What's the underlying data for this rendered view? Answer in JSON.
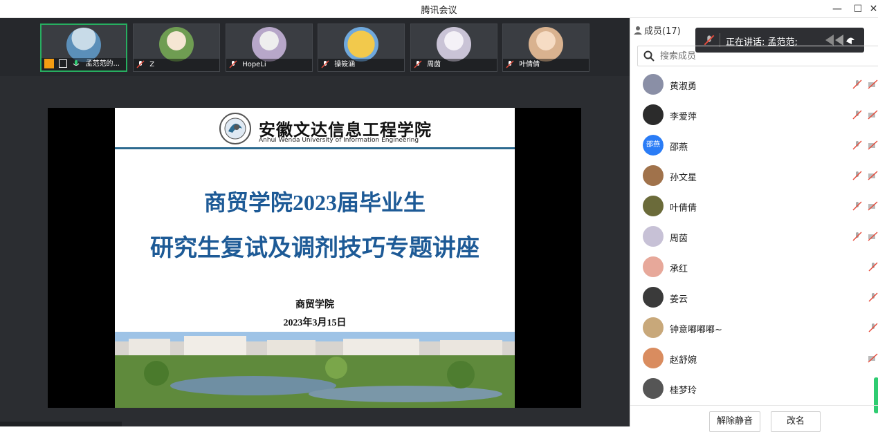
{
  "window": {
    "title": "腾讯会议",
    "minimize": "—",
    "maximize": "☐",
    "close": "✕"
  },
  "video_strip": [
    {
      "name": "孟范范的...",
      "active": true,
      "color": "#5b8fb9"
    },
    {
      "name": "Z",
      "active": false,
      "color": "#6f9d52"
    },
    {
      "name": "HopeLi",
      "active": false,
      "color": "#b7a7c9"
    },
    {
      "name": "操筱涵",
      "active": false,
      "color": "#f2c94c"
    },
    {
      "name": "周茵",
      "active": false,
      "color": "#c9c3d6"
    },
    {
      "name": "叶倩倩",
      "active": false,
      "color": "#d9b28f"
    }
  ],
  "slide": {
    "university_cn": "安徽文达信息工程学院",
    "university_en": "Anhui Wenda University of Information Engineering",
    "title_line1": "商贸学院2023届毕业生",
    "title_line2": "研究生复试及调剂技巧专题讲座",
    "organizer": "商贸学院",
    "date": "2023年3月15日"
  },
  "panel": {
    "members_label": "成员(17)",
    "speaking_popup": "正在讲话: 孟范范;",
    "search_placeholder": "搜索成员",
    "members": [
      {
        "name": "黄淑勇",
        "avatar_color": "#8a8fa6",
        "avatar_text": ""
      },
      {
        "name": "李爱萍",
        "avatar_color": "#2b2b2b",
        "avatar_text": ""
      },
      {
        "name": "邵燕",
        "avatar_color": "#2a7cf6",
        "avatar_text": "邵燕"
      },
      {
        "name": "孙文星",
        "avatar_color": "#a0724b",
        "avatar_text": ""
      },
      {
        "name": "叶倩倩",
        "avatar_color": "#6b6b3a",
        "avatar_text": ""
      },
      {
        "name": "周茵",
        "avatar_color": "#c7c1d6",
        "avatar_text": ""
      },
      {
        "name": "承红",
        "avatar_color": "#e7a89a",
        "avatar_text": ""
      },
      {
        "name": "姜云",
        "avatar_color": "#3a3a3a",
        "avatar_text": ""
      },
      {
        "name": "钟意嘟嘟嘟~",
        "avatar_color": "#c8a87a",
        "avatar_text": ""
      },
      {
        "name": "赵舒婉",
        "avatar_color": "#d98c5f",
        "avatar_text": ""
      },
      {
        "name": "桂梦玲",
        "avatar_color": "#555555",
        "avatar_text": ""
      }
    ],
    "unmute_button": "解除静音",
    "rename_button": "改名"
  }
}
